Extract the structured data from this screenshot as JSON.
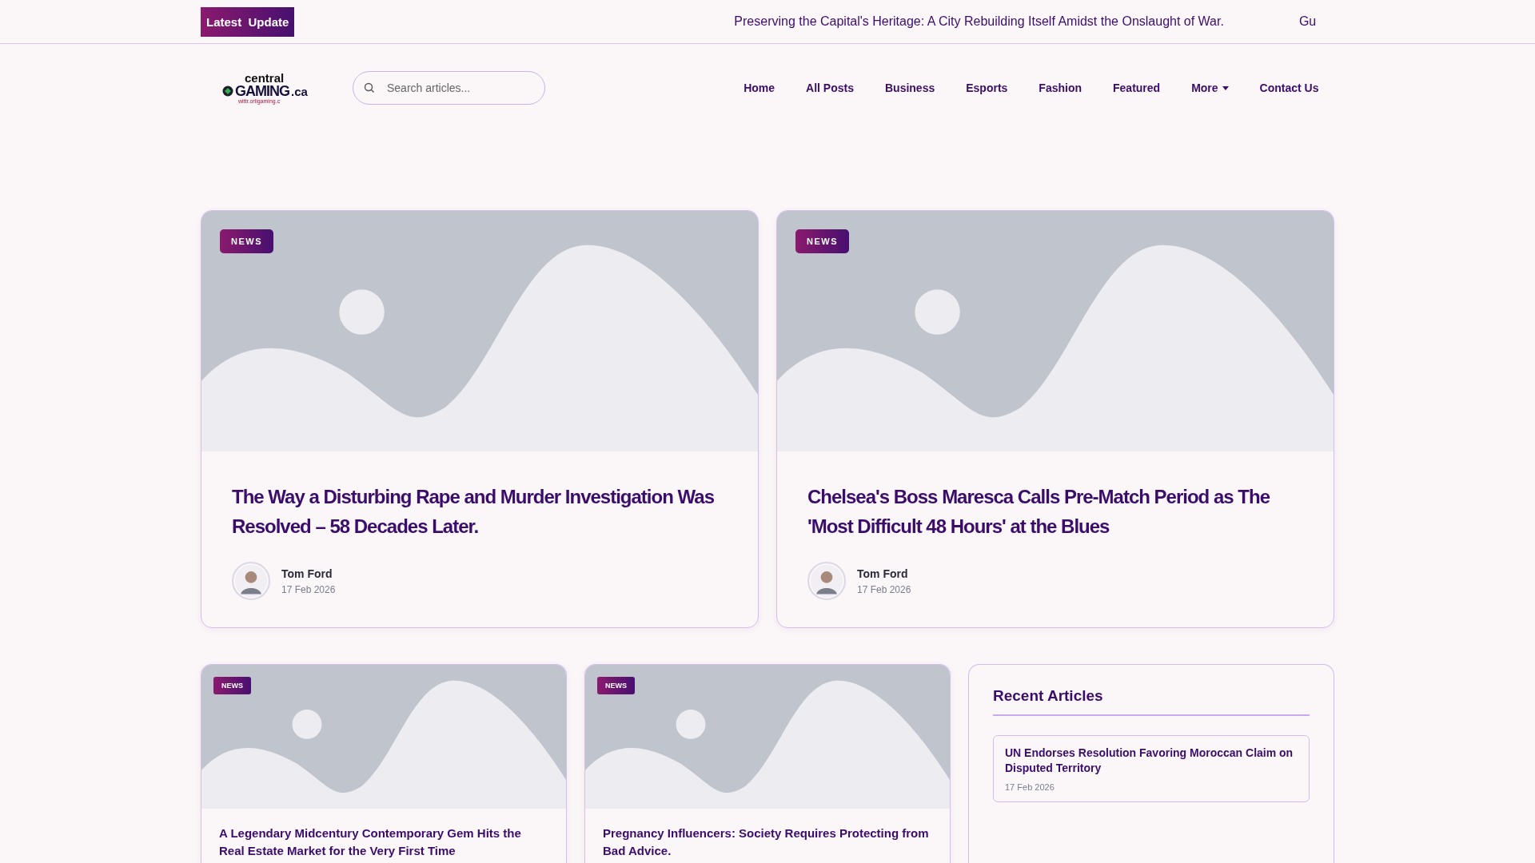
{
  "ticker": {
    "label": "Latest  Update",
    "items": [
      "Preserving the Capital's Heritage: A City Rebuilding Itself Amidst the Onslaught of War.",
      "Gu"
    ]
  },
  "logo": {
    "top": "central",
    "main": "GAMING",
    "suffix": ".ca",
    "tagline": "wittr.orligaming.c"
  },
  "search": {
    "placeholder": "Search articles..."
  },
  "nav": [
    {
      "label": "Home",
      "kind": "link"
    },
    {
      "label": "All Posts",
      "kind": "link"
    },
    {
      "label": "Business",
      "kind": "link"
    },
    {
      "label": "Esports",
      "kind": "link"
    },
    {
      "label": "Fashion",
      "kind": "link"
    },
    {
      "label": "Featured",
      "kind": "link"
    },
    {
      "label": "More",
      "kind": "dropdown"
    },
    {
      "label": "Contact Us",
      "kind": "link"
    }
  ],
  "featured": [
    {
      "badge": "NEWS",
      "title": "The Way a Disturbing Rape and Murder Investigation Was Resolved – 58 Decades Later.",
      "author": "Tom Ford",
      "date": "17 Feb 2026"
    },
    {
      "badge": "NEWS",
      "title": "Chelsea's Boss Maresca Calls Pre-Match Period as The 'Most Difficult 48 Hours' at the Blues",
      "author": "Tom Ford",
      "date": "17 Feb 2026"
    }
  ],
  "posts": [
    {
      "badge": "NEWS",
      "title": "A Legendary Midcentury Contemporary Gem Hits the Real Estate Market for the Very First Time"
    },
    {
      "badge": "NEWS",
      "title": "Pregnancy Influencers: Society Requires Protecting from Bad Advice."
    }
  ],
  "sidebar": {
    "title": "Recent Articles",
    "items": [
      {
        "title": "UN Endorses Resolution Favoring Moroccan Claim on Disputed Territory",
        "date": "17 Feb 2026"
      }
    ]
  }
}
